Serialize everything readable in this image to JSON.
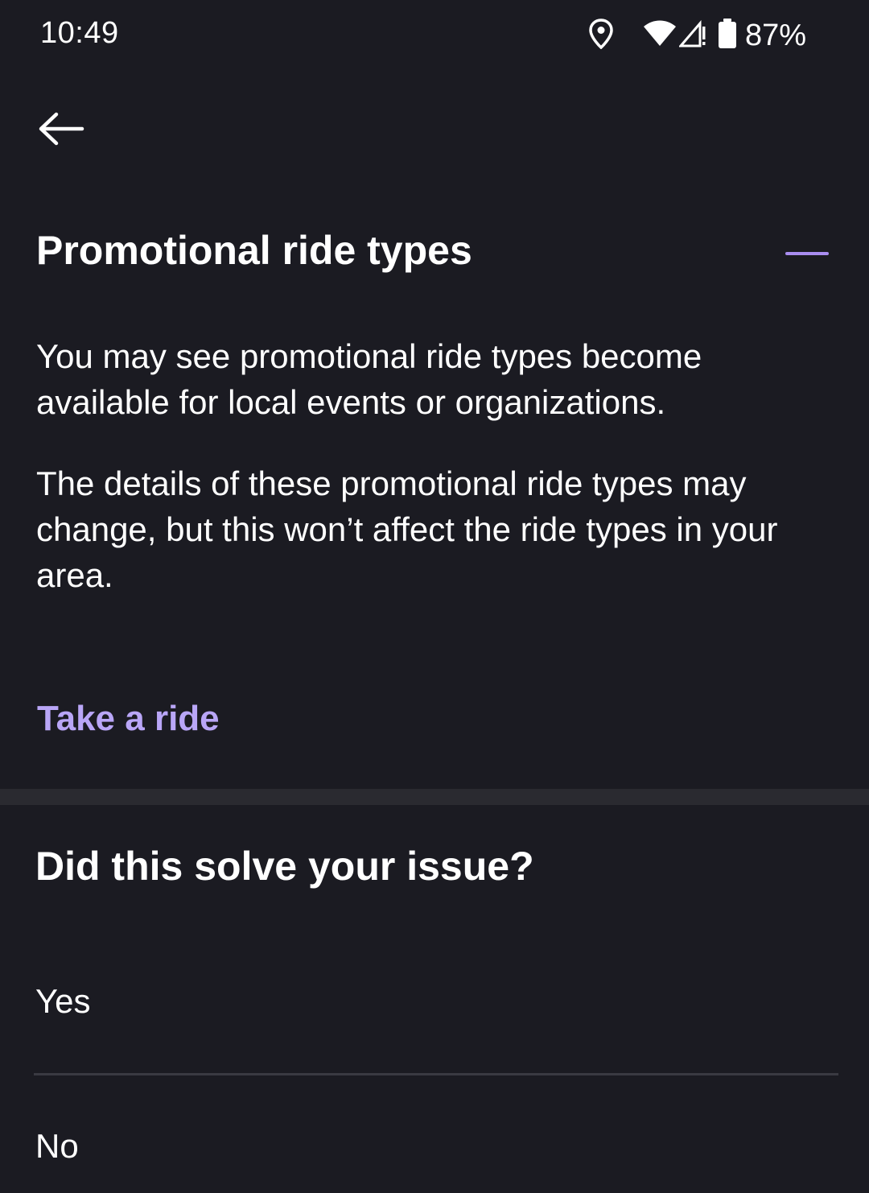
{
  "status_bar": {
    "time": "10:49",
    "battery_percent": "87%",
    "icons": [
      "location-icon",
      "wifi-icon",
      "signal-icon",
      "battery-icon"
    ]
  },
  "nav": {
    "back_icon": "arrow-left-icon"
  },
  "section": {
    "title": "Promotional ride types",
    "collapse_icon": "minus-icon",
    "paragraphs": [
      "You may see promotional ride types become available for local events or organizations.",
      "The details of these promotional ride types may change, but this won’t affect the ride types in your area."
    ],
    "cta_label": "Take a ride"
  },
  "feedback": {
    "question": "Did this solve your issue?",
    "options": [
      "Yes",
      "No"
    ]
  },
  "colors": {
    "background": "#1b1b22",
    "accent": "#b9a6f7",
    "accent_line": "#a98df0",
    "divider": "#2a2a30"
  }
}
